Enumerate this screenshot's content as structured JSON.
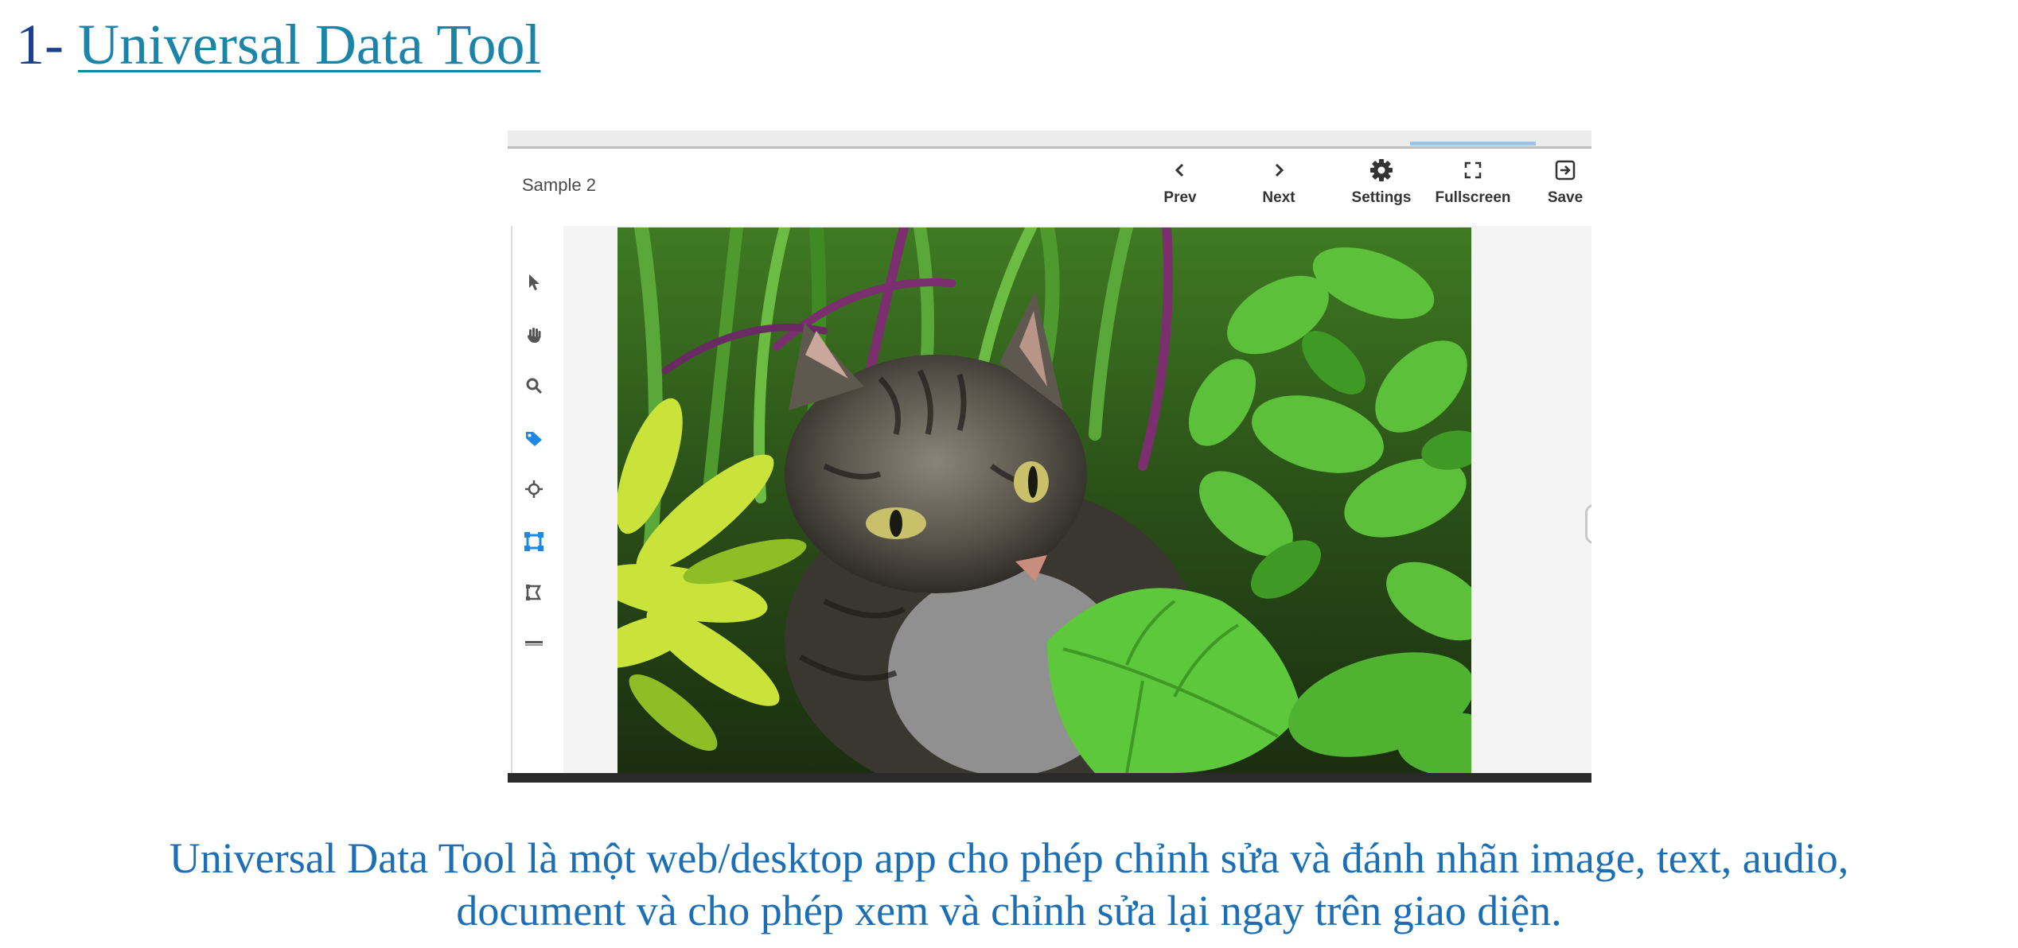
{
  "heading": {
    "number": "1-",
    "link_text": "Universal Data Tool"
  },
  "app": {
    "sample_label": "Sample 2",
    "toolbar": [
      {
        "label": "Prev",
        "icon": "chevron-left-icon"
      },
      {
        "label": "Next",
        "icon": "chevron-right-icon"
      },
      {
        "label": "Settings",
        "icon": "gear-icon"
      },
      {
        "label": "Fullscreen",
        "icon": "fullscreen-icon"
      },
      {
        "label": "Save",
        "icon": "exit-to-app-icon"
      }
    ],
    "tools": [
      "pointer-icon",
      "pan-hand-icon",
      "zoom-icon",
      "tag-icon",
      "crosshair-point-icon",
      "bounding-box-icon",
      "polygon-icon",
      "line-icon"
    ],
    "active_tool_color": "#1e88e5"
  },
  "caption": {
    "line1": "Universal Data Tool là một web/desktop app cho phép chỉnh sửa và đánh nhãn image, text, audio,",
    "line2": "document và cho phép xem và chỉnh sửa lại ngay trên giao diện."
  }
}
